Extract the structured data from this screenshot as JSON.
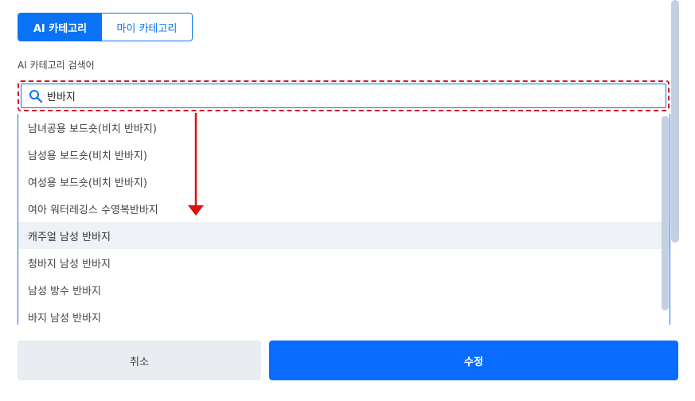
{
  "tabs": {
    "ai_category": "AI 카테고리",
    "my_category": "마이 카테고리"
  },
  "search": {
    "label": "AI 카테고리 검색어",
    "value": "반바지"
  },
  "options": [
    "남녀공용 보드숏(비치 반바지)",
    "남성용 보드숏(비치 반바지)",
    "여성용 보드숏(비치 반바지)",
    "여아 워터레깅스 수영복반바지",
    "캐주얼 남성 반바지",
    "청바지 남성 반바지",
    "남성 방수 반바지",
    "바지 남성 반바지"
  ],
  "buttons": {
    "cancel": "취소",
    "submit": "수정"
  },
  "colors": {
    "accent": "#0a73f5",
    "highlight_border": "#cc1b2b",
    "arrow": "#e01010"
  }
}
